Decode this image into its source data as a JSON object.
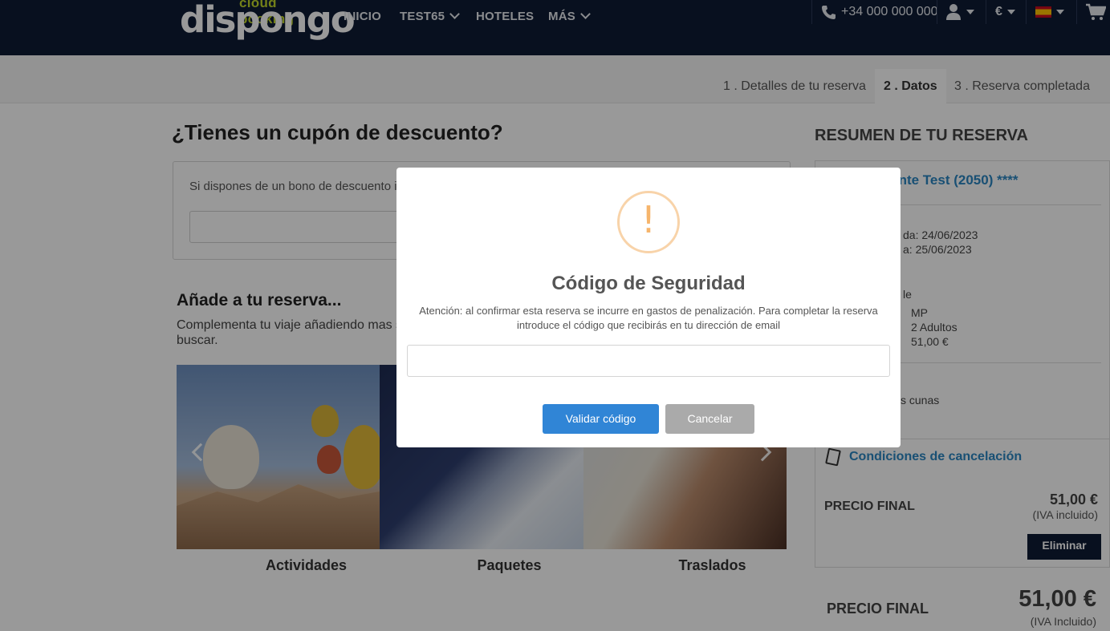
{
  "header": {
    "logo_small": "cloud booking",
    "logo_brand": "dispongo",
    "nav": [
      "INICIO",
      "TEST65",
      "HOTELES",
      "MÁS"
    ],
    "phone": "+34 000 000 000",
    "currency": "€",
    "accent": "#c0d62b",
    "bg": "#0e1b34"
  },
  "steps": [
    {
      "label": "1 . Detalles de tu reserva"
    },
    {
      "label": "2 . Datos"
    },
    {
      "label": "3 . Reserva completada"
    }
  ],
  "coupon": {
    "title": "¿Tienes un cupón de descuento?",
    "text": "Si dispones de un bono de descuento in"
  },
  "extras": {
    "title": "Añade a tu reserva...",
    "text_line1": "Complementa tu viaje añadiendo mas s",
    "text_line2": "buscar.",
    "tiles": [
      "Actividades",
      "Paquetes",
      "Traslados"
    ]
  },
  "summary": {
    "title": "RESUMEN DE TU RESERVA",
    "hotel": "mente Test (2050) ****",
    "checkin": "da: 24/06/2023",
    "checkout": "a: 25/06/2023",
    "room_frag": "le",
    "board": "MP",
    "guests": "2 Adultos",
    "room_price": "51,00 €",
    "cribs": "s cunas",
    "cancel_conditions": "Condiciones de cancelación",
    "final_label": "PRECIO FINAL",
    "final_value": "51,00 €",
    "iva": "(IVA incluido)",
    "delete_label": "Eliminar",
    "total_label": "PRECIO FINAL",
    "total_value": "51,00 €",
    "total_iva": "(IVA Incluido)"
  },
  "modal": {
    "icon": "!",
    "title": "Código de Seguridad",
    "text_line1": "Atención: al confirmar esta reserva se incurre en gastos de penalización. Para completar la reserva",
    "text_line2": "introduce el código que recibirás en tu dirección de email",
    "input_value": "",
    "confirm_label": "Validar código",
    "cancel_label": "Cancelar",
    "confirm_color": "#3085d6",
    "warn_color": "#f6b56c"
  }
}
